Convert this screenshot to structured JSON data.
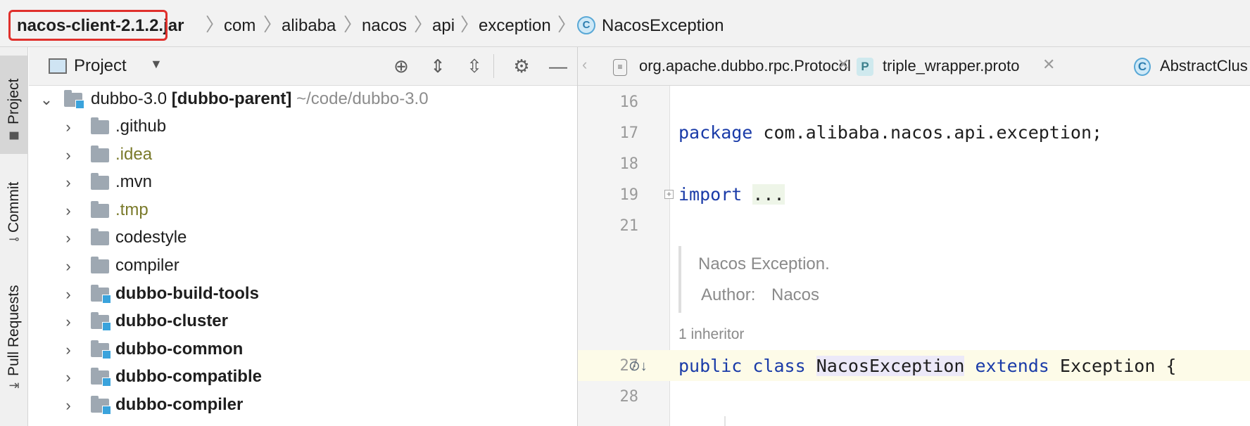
{
  "breadcrumb": {
    "jar": "nacos-client-2.1.2.jar",
    "parts": [
      "com",
      "alibaba",
      "nacos",
      "api",
      "exception"
    ],
    "class_badge": "C",
    "class_name": "NacosException",
    "highlight_color": "#e0302c"
  },
  "toolstrip": {
    "tabs": [
      {
        "label": "Project",
        "icon": "folder-icon"
      },
      {
        "label": "Commit",
        "icon": "commit-icon"
      },
      {
        "label": "Pull Requests",
        "icon": "pull-request-icon"
      }
    ]
  },
  "project_panel": {
    "title": "Project",
    "toolbar_icons": [
      "locate-icon",
      "expand-all-icon",
      "collapse-all-icon",
      "gear-icon",
      "minimize-icon"
    ],
    "root": {
      "name": "dubbo-3.0",
      "module": "[dubbo-parent]",
      "path": "~/code/dubbo-3.0"
    },
    "items": [
      {
        "label": ".github",
        "style": "normal",
        "module": false
      },
      {
        "label": ".idea",
        "style": "olive",
        "module": false
      },
      {
        "label": ".mvn",
        "style": "normal",
        "module": false
      },
      {
        "label": ".tmp",
        "style": "olive",
        "module": false
      },
      {
        "label": "codestyle",
        "style": "normal",
        "module": false
      },
      {
        "label": "compiler",
        "style": "normal",
        "module": false
      },
      {
        "label": "dubbo-build-tools",
        "style": "bold",
        "module": true
      },
      {
        "label": "dubbo-cluster",
        "style": "bold",
        "module": true
      },
      {
        "label": "dubbo-common",
        "style": "bold",
        "module": true
      },
      {
        "label": "dubbo-compatible",
        "style": "bold",
        "module": true
      },
      {
        "label": "dubbo-compiler",
        "style": "bold",
        "module": true
      }
    ]
  },
  "tabs": [
    {
      "label": "org.apache.dubbo.rpc.Protocol",
      "icon": "file-icon",
      "badge": ""
    },
    {
      "label": "triple_wrapper.proto",
      "icon": "proto-file-icon",
      "badge": "P"
    },
    {
      "label": "AbstractClus",
      "icon": "class-icon",
      "badge": "C"
    }
  ],
  "editor": {
    "line_numbers": [
      "16",
      "17",
      "18",
      "19",
      "21",
      "27",
      "28"
    ],
    "package_kw": "package",
    "package_name": " com.alibaba.nacos.api.exception;",
    "import_kw": "import",
    "import_dots": "...",
    "doc_line1": "Nacos Exception.",
    "doc_author_label": "Author:",
    "doc_author": "Nacos",
    "inheritors": "1 inheritor",
    "kw_public": "public",
    "kw_class": "class",
    "class_name": "NacosException",
    "kw_extends": "extends",
    "superclass": "Exception",
    "brace": " {"
  }
}
